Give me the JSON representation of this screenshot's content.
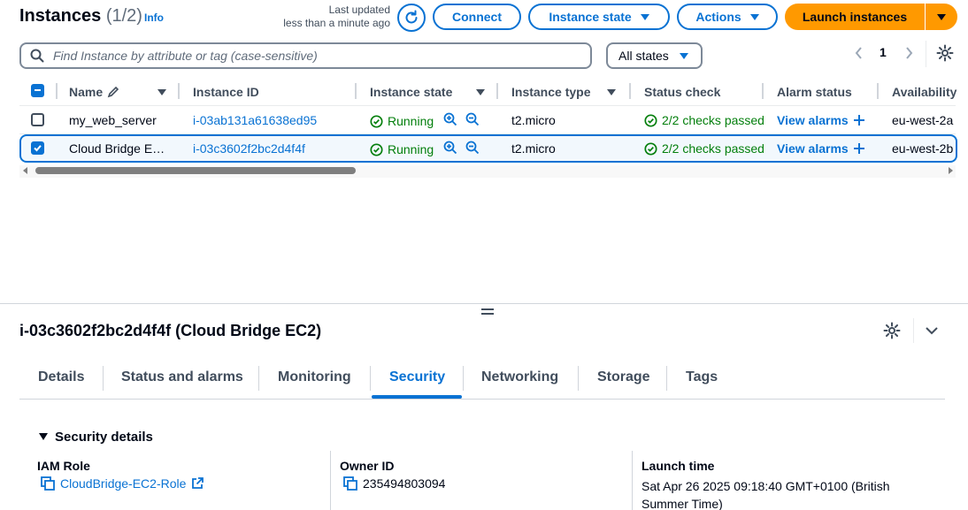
{
  "header": {
    "title": "Instances",
    "count": "(1/2)",
    "info": "Info",
    "last_updated_line1": "Last updated",
    "last_updated_line2": "less than a minute ago",
    "connect": "Connect",
    "instance_state": "Instance state",
    "actions": "Actions",
    "launch": "Launch instances"
  },
  "search": {
    "placeholder": "Find Instance by attribute or tag (case-sensitive)",
    "filter_value": "All states",
    "page": "1"
  },
  "table": {
    "columns": [
      "Name",
      "Instance ID",
      "Instance state",
      "Instance type",
      "Status check",
      "Alarm status",
      "Availability"
    ],
    "rows": [
      {
        "selected": false,
        "name": "my_web_server",
        "id": "i-03ab131a61638ed95",
        "state": "Running",
        "type": "t2.micro",
        "status": "2/2 checks passed",
        "alarm": "View alarms",
        "az": "eu-west-2a"
      },
      {
        "selected": true,
        "name": "Cloud Bridge E…",
        "id": "i-03c3602f2bc2d4f4f",
        "state": "Running",
        "type": "t2.micro",
        "status": "2/2 checks passed",
        "alarm": "View alarms",
        "az": "eu-west-2b"
      }
    ]
  },
  "detail": {
    "title": "i-03c3602f2bc2d4f4f (Cloud Bridge EC2)",
    "tabs": [
      "Details",
      "Status and alarms",
      "Monitoring",
      "Security",
      "Networking",
      "Storage",
      "Tags"
    ],
    "active_tab": "Security",
    "section": "Security details",
    "iam_role_label": "IAM Role",
    "iam_role_value": "CloudBridge-EC2-Role",
    "owner_label": "Owner ID",
    "owner_value": "235494803094",
    "launch_label": "Launch time",
    "launch_value_line1": "Sat Apr 26 2025 09:18:40 GMT+0100 (British",
    "launch_value_line2": "Summer Time)"
  },
  "colors": {
    "accent": "#0972d3",
    "primary_button": "#ff9900",
    "success": "#037f0c",
    "selected_row_bg": "#f2f8fd"
  }
}
